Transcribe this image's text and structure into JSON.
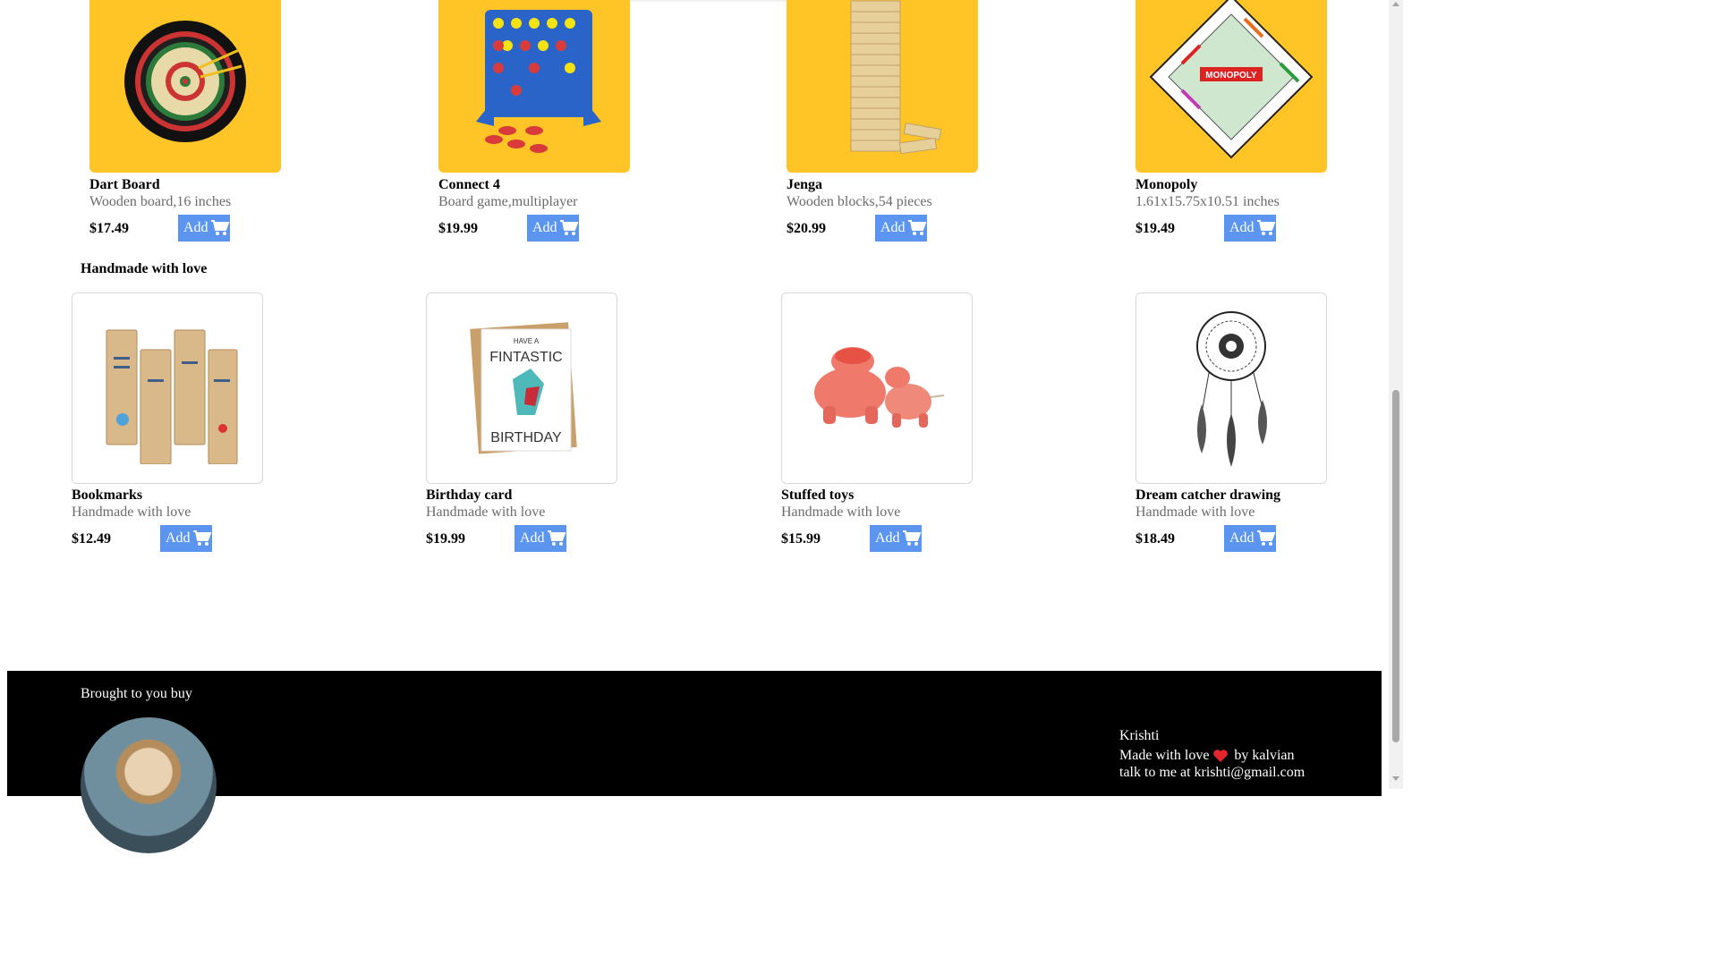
{
  "games": [
    {
      "title": "Dart Board",
      "subtitle": "Wooden board,16 inches",
      "price": "$17.49",
      "add_label": "Add",
      "icon": "dartboard-image"
    },
    {
      "title": "Connect 4",
      "subtitle": "Board game,multiplayer",
      "price": "$19.99",
      "add_label": "Add",
      "icon": "connect4-image"
    },
    {
      "title": "Jenga",
      "subtitle": "Wooden blocks,54 pieces",
      "price": "$20.99",
      "add_label": "Add",
      "icon": "jenga-image"
    },
    {
      "title": "Monopoly",
      "subtitle": "1.61x15.75x10.51 inches",
      "price": "$19.49",
      "add_label": "Add",
      "icon": "monopoly-image",
      "logo_text": "MONOPOLY"
    }
  ],
  "handmade_section_title": "Handmade with love",
  "handmade": [
    {
      "title": "Bookmarks",
      "subtitle": "Handmade with love",
      "price": "$12.49",
      "add_label": "Add",
      "icon": "bookmarks-image"
    },
    {
      "title": "Birthday card",
      "subtitle": "Handmade with love",
      "price": "$19.99",
      "add_label": "Add",
      "icon": "birthday-card-image",
      "card_text": [
        "HAVE A",
        "FINTASTIC",
        "BIRTHDAY"
      ]
    },
    {
      "title": "Stuffed toys",
      "subtitle": "Handmade with love",
      "price": "$15.99",
      "add_label": "Add",
      "icon": "stuffed-toys-image"
    },
    {
      "title": "Dream catcher drawing",
      "subtitle": "Handmade with love",
      "price": "$18.49",
      "add_label": "Add",
      "icon": "dreamcatcher-image"
    }
  ],
  "footer": {
    "brought": "Brought to you buy",
    "name": "Krishti",
    "made_prefix": "Made with love",
    "made_suffix": "by kalvian",
    "talk": "talk to me at krishti@gmail.com"
  },
  "colors": {
    "accent": "#5b95ef",
    "product_bg": "#ffc425",
    "footer_bg": "#000000"
  }
}
